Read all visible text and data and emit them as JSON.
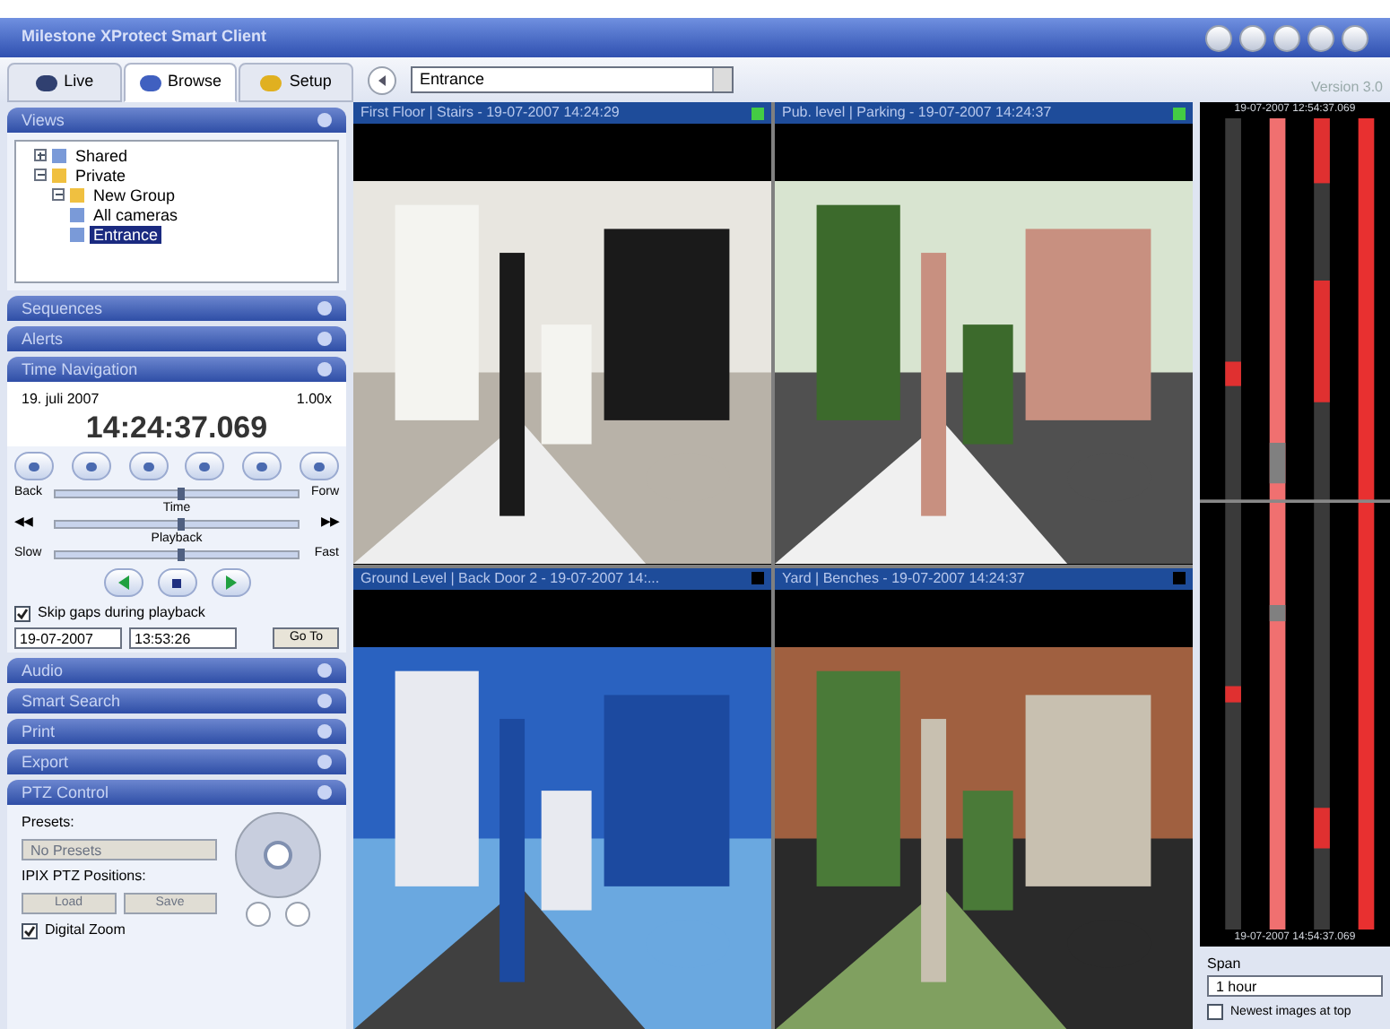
{
  "window": {
    "title": "Milestone XProtect Smart Client",
    "version": "Version 3.0"
  },
  "tabs": [
    {
      "label": "Live",
      "selected": false
    },
    {
      "label": "Browse",
      "selected": true
    },
    {
      "label": "Setup",
      "selected": false
    }
  ],
  "view_selector": {
    "value": "Entrance"
  },
  "views": {
    "title": "Views",
    "tree": [
      {
        "label": "Shared",
        "selected": false,
        "expanded": false
      },
      {
        "label": "Private",
        "selected": false,
        "expanded": true,
        "children": [
          {
            "label": "New Group",
            "selected": false,
            "expanded": true,
            "children": [
              {
                "label": "All cameras",
                "selected": false
              },
              {
                "label": "Entrance",
                "selected": true
              }
            ]
          }
        ]
      }
    ]
  },
  "collapsed_panels_top": [
    "Sequences",
    "Alerts"
  ],
  "time_navigation": {
    "title": "Time Navigation",
    "date": "19. juli 2007",
    "speed": "1.00x",
    "time": "14:24:37.069",
    "sliders": [
      {
        "left": "Back",
        "caption": "Time",
        "right": "Forw",
        "level": 0.5
      },
      {
        "left": "◀◀",
        "caption": "Playback",
        "right": "▶▶",
        "level": 0.5
      },
      {
        "left": "Slow",
        "right": "Fast",
        "level": 0.5
      }
    ],
    "skip_gaps": {
      "label": "Skip gaps during playback",
      "checked": true
    },
    "goto_date": "19-07-2007",
    "goto_time": "13:53:26",
    "goto_button": "Go To"
  },
  "collapsed_panels_bottom": [
    "Audio",
    "Smart Search",
    "Print",
    "Export"
  ],
  "ptz": {
    "title": "PTZ Control",
    "presets_label": "Presets:",
    "presets_value": "No Presets",
    "positions_label": "IPIX PTZ Positions:",
    "buttons": [
      "Load",
      "Save"
    ],
    "digital_zoom": {
      "label": "Digital Zoom",
      "checked": true
    }
  },
  "cameras": [
    {
      "title": "First Floor | Stairs - 19-07-2007 14:24:29",
      "color": "#44cc44"
    },
    {
      "title": "Pub. level | Parking - 19-07-2007 14:24:37",
      "color": "#44cc44"
    },
    {
      "title": "Ground Level | Back Door 2 - 19-07-2007 14:...",
      "color": "#000000"
    },
    {
      "title": "Yard | Benches - 19-07-2007 14:24:37",
      "color": "#000000"
    }
  ],
  "timeline": {
    "start": "19-07-2007 12:54:37.069",
    "end": "19-07-2007 14:54:37.069",
    "span_label": "Span",
    "span_value": "1 hour",
    "newest_top": {
      "label": "Newest images at top",
      "checked": false
    }
  }
}
